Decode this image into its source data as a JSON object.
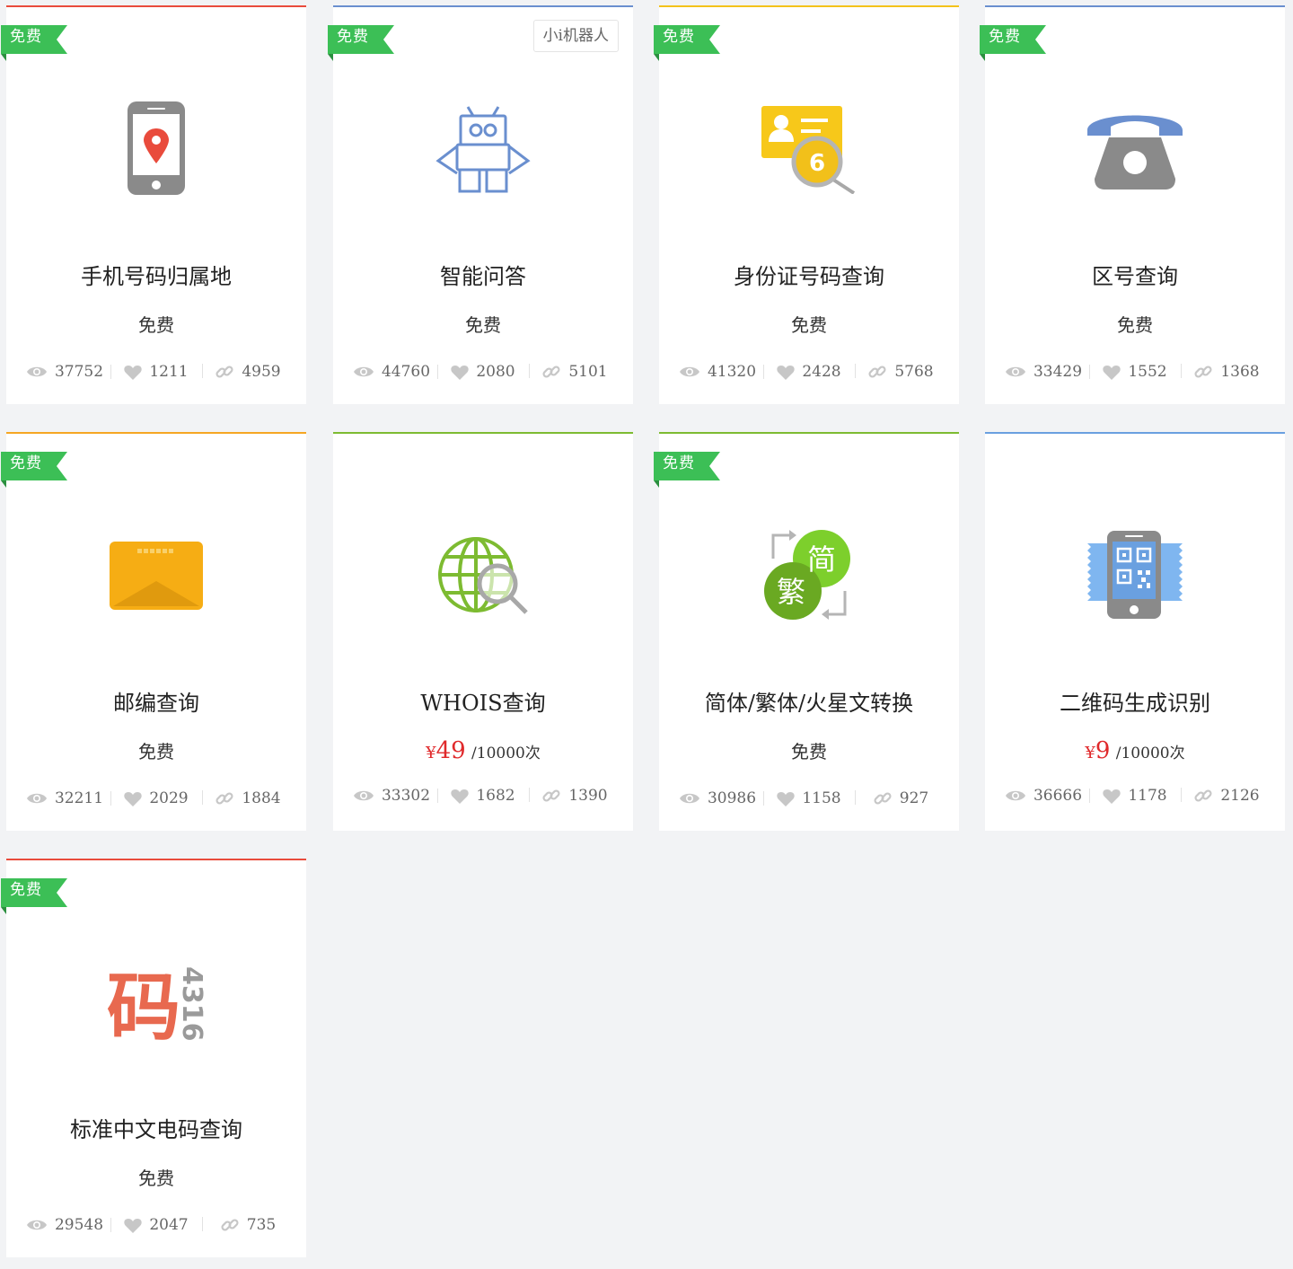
{
  "colors": {
    "badge_green": "#3cbf56",
    "price_red": "#e0292b",
    "card_top_red": "#e94b3c",
    "card_top_blue": "#6a8fcf",
    "card_top_yellow": "#f3c21b",
    "card_top_orange": "#f5a623",
    "card_top_green": "#7dbb31"
  },
  "cards": [
    {
      "badge": "免费",
      "tag": "",
      "icon": "phone-location-icon",
      "title": "手机号码归属地",
      "price_text": "免费",
      "price_currency": "",
      "price_amount": "",
      "price_unit": "",
      "views": "37752",
      "likes": "1211",
      "links": "4959"
    },
    {
      "badge": "免费",
      "tag": "小i机器人",
      "icon": "robot-icon",
      "title": "智能问答",
      "price_text": "免费",
      "price_currency": "",
      "price_amount": "",
      "price_unit": "",
      "views": "44760",
      "likes": "2080",
      "links": "5101"
    },
    {
      "badge": "免费",
      "tag": "",
      "icon": "id-card-search-icon",
      "title": "身份证号码查询",
      "price_text": "免费",
      "price_currency": "",
      "price_amount": "",
      "price_unit": "",
      "views": "41320",
      "likes": "2428",
      "links": "5768"
    },
    {
      "badge": "免费",
      "tag": "",
      "icon": "telephone-icon",
      "title": "区号查询",
      "price_text": "免费",
      "price_currency": "",
      "price_amount": "",
      "price_unit": "",
      "views": "33429",
      "likes": "1552",
      "links": "1368"
    },
    {
      "badge": "免费",
      "tag": "",
      "icon": "envelope-icon",
      "title": "邮编查询",
      "price_text": "免费",
      "price_currency": "",
      "price_amount": "",
      "price_unit": "",
      "views": "32211",
      "likes": "2029",
      "links": "1884"
    },
    {
      "badge": "",
      "tag": "",
      "icon": "globe-search-icon",
      "title": "WHOIS查询",
      "price_text": "",
      "price_currency": "¥",
      "price_amount": "49",
      "price_unit": "/10000次",
      "views": "33302",
      "likes": "1682",
      "links": "1390"
    },
    {
      "badge": "免费",
      "tag": "",
      "icon": "simplified-traditional-convert-icon",
      "icon_text_a": "简",
      "icon_text_b": "繁",
      "title": "简体/繁体/火星文转换",
      "price_text": "免费",
      "price_currency": "",
      "price_amount": "",
      "price_unit": "",
      "views": "30986",
      "likes": "1158",
      "links": "927"
    },
    {
      "badge": "",
      "tag": "",
      "icon": "qr-phone-icon",
      "title": "二维码生成识别",
      "price_text": "",
      "price_currency": "¥",
      "price_amount": "9",
      "price_unit": "/10000次",
      "views": "36666",
      "likes": "1178",
      "links": "2126"
    },
    {
      "badge": "免费",
      "tag": "",
      "icon": "chinese-telegraph-code-icon",
      "icon_text_a": "码",
      "icon_text_b": "4316",
      "title": "标准中文电码查询",
      "price_text": "免费",
      "price_currency": "",
      "price_amount": "",
      "price_unit": "",
      "views": "29548",
      "likes": "2047",
      "links": "735"
    }
  ]
}
